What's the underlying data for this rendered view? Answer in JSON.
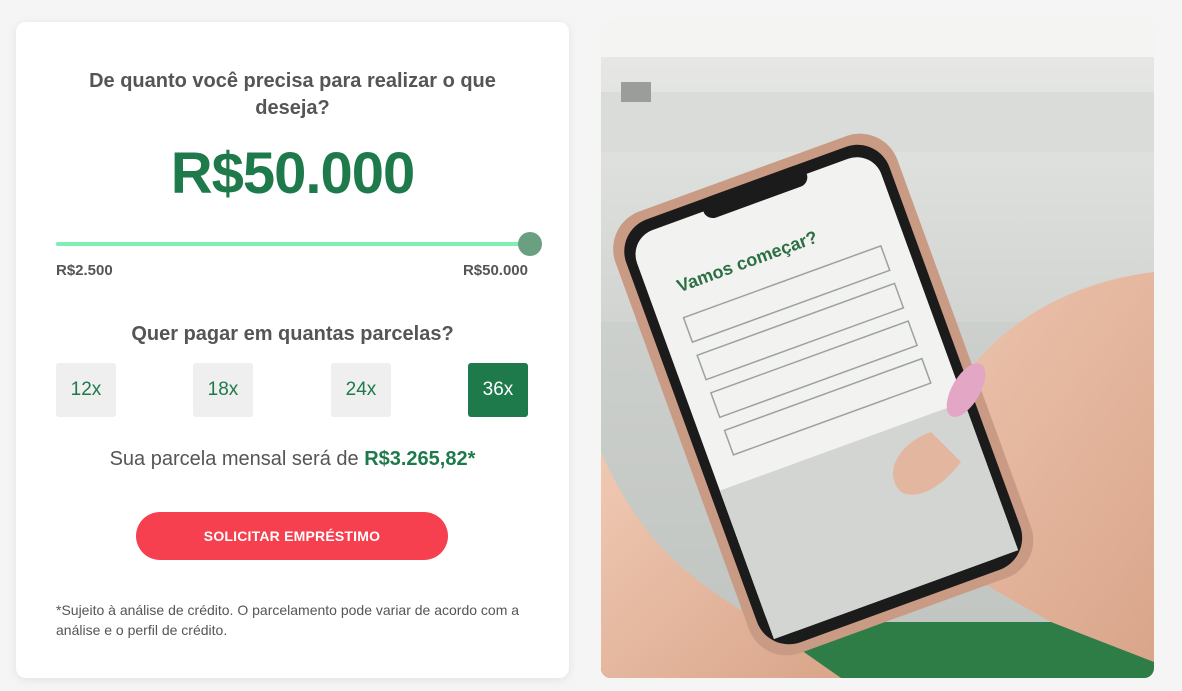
{
  "calculator": {
    "question": "De quanto você precisa para realizar o que deseja?",
    "amount": "R$50.000",
    "slider": {
      "min_label": "R$2.500",
      "max_label": "R$50.000",
      "value_fraction": 1.0
    },
    "installments_question": "Quer pagar em quantas parcelas?",
    "installment_options": [
      "12x",
      "18x",
      "24x",
      "36x"
    ],
    "selected_installment": "36x",
    "monthly_prefix": "Sua parcela mensal será de ",
    "monthly_value": "R$3.265,82*",
    "cta_label": "SOLICITAR EMPRÉSTIMO",
    "disclaimer": "*Sujeito à análise de crédito. O parcelamento pode variar de acordo com a análise e o perfil de crédito."
  },
  "photo": {
    "phone_heading": "Vamos começar?",
    "colors": {
      "accent": "#1e7a4a",
      "cta": "#f6404f",
      "slider_fill": "#7ff0b2"
    }
  }
}
